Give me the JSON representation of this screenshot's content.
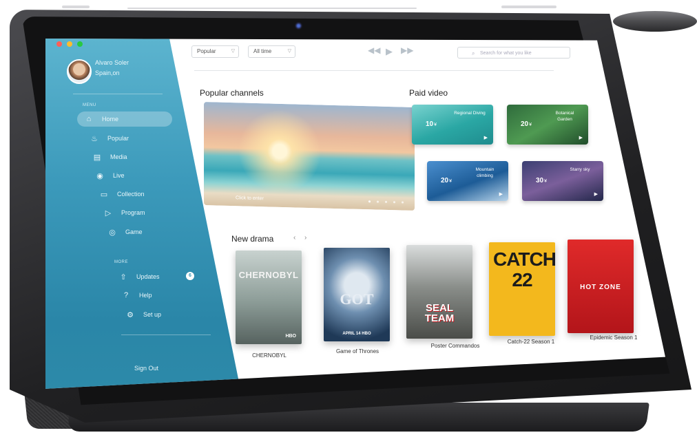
{
  "user": {
    "name": "Alvaro Soler",
    "location": "Spain,on"
  },
  "sidebar": {
    "menu_label": "MENU",
    "more_label": "MORE",
    "items": [
      {
        "label": "Home",
        "icon": "home-icon"
      },
      {
        "label": "Popular",
        "icon": "flame-icon"
      },
      {
        "label": "Media",
        "icon": "media-icon"
      },
      {
        "label": "Live",
        "icon": "live-icon"
      },
      {
        "label": "Collection",
        "icon": "folder-icon"
      },
      {
        "label": "Program",
        "icon": "program-icon"
      },
      {
        "label": "Game",
        "icon": "gamepad-icon"
      }
    ],
    "more_items": [
      {
        "label": "Updates",
        "icon": "upload-icon",
        "badge": "6"
      },
      {
        "label": "Help",
        "icon": "help-icon"
      },
      {
        "label": "Set up",
        "icon": "gear-icon"
      }
    ],
    "sign_out": "Sign Out"
  },
  "toolbar": {
    "sort_value": "Popular",
    "time_value": "All time",
    "search_placeholder": "Search for what you like"
  },
  "popular": {
    "title": "Popular channels",
    "hero_caption": "Click to enter"
  },
  "paid": {
    "title": "Paid video",
    "tiles": [
      {
        "price": "10",
        "unit": "¥",
        "name": "Regional Diving"
      },
      {
        "price": "20",
        "unit": "¥",
        "name": "Botanical Garden"
      },
      {
        "price": "20",
        "unit": "¥",
        "name": "Mountain climbing"
      },
      {
        "price": "30",
        "unit": "¥",
        "name": "Starry sky"
      }
    ]
  },
  "drama": {
    "title": "New drama",
    "items": [
      {
        "poster_text": "CHERNOBYL",
        "sub": "HBO",
        "caption": "CHERNOBYL"
      },
      {
        "poster_text": "GOT",
        "sub": "APRIL 14 HBO",
        "caption": "Game of Thrones"
      },
      {
        "poster_text": "SEAL TEAM",
        "sub": "",
        "caption": "Poster Commandos"
      },
      {
        "poster_text": "CATCH 22",
        "sub": "",
        "caption": "Catch-22 Season 1"
      },
      {
        "poster_text": "HOT ZONE",
        "sub": "",
        "caption": "Epidemic Season 1"
      }
    ]
  },
  "colors": {
    "sidebar_top": "#5cb4cf",
    "sidebar_bottom": "#2a86a8",
    "accent": "#3a96b8"
  }
}
